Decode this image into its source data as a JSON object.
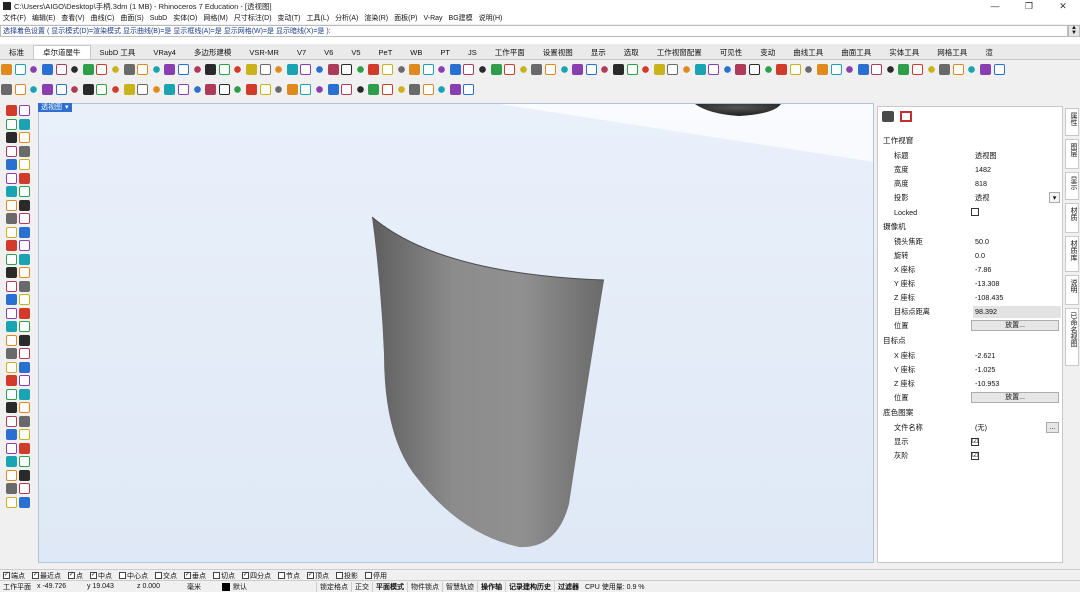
{
  "window": {
    "title": "C:\\Users\\AIGO\\Desktop\\手柄.3dm (1 MB) - Rhinoceros 7 Education - [透视图]",
    "controls": [
      "—",
      "❐",
      "✕"
    ]
  },
  "menubar": [
    "文件(F)",
    "编辑(E)",
    "查看(V)",
    "曲线(C)",
    "曲面(S)",
    "SubD",
    "实体(O)",
    "网格(M)",
    "尺寸标注(D)",
    "变动(T)",
    "工具(L)",
    "分析(A)",
    "渲染(R)",
    "面板(P)",
    "V-Ray",
    "BG建模",
    "说明(H)"
  ],
  "command_prompt": "选择着色设置 ( 显示模式(D)=渲染模式  显示曲线(B)=是  显示框线(A)=是  显示网格(W)=是  显示暗线(X)=是 ):",
  "tabs": [
    "标准",
    "卓尔道屋牛",
    "SubD 工具",
    "VRay4",
    "多边形建模",
    "VSR-MR",
    "V7",
    "V6",
    "V5",
    "PeT",
    "WB",
    "PT",
    "JS",
    "工作平面",
    "设置视图",
    "显示",
    "选取",
    "工作视窗配置",
    "可见性",
    "变动",
    "曲线工具",
    "曲面工具",
    "实体工具",
    "网格工具",
    "渲"
  ],
  "active_tab": "卓尔道屋牛",
  "viewport": {
    "tab_label": "透视图"
  },
  "properties": {
    "sections": {
      "viewport": "工作视窗",
      "camera": "摄像机",
      "target": "目标点",
      "wallpaper": "底色图案"
    },
    "viewport_rows": [
      {
        "label": "标题",
        "value": "透视图"
      },
      {
        "label": "宽度",
        "value": "1482"
      },
      {
        "label": "高度",
        "value": "818"
      },
      {
        "label": "投影",
        "value": "透视"
      },
      {
        "label": "Locked",
        "value": ""
      }
    ],
    "camera_rows": [
      {
        "label": "镜头焦距",
        "value": "50.0"
      },
      {
        "label": "旋转",
        "value": "0.0"
      },
      {
        "label": "X 座标",
        "value": "-7.86"
      },
      {
        "label": "Y 座标",
        "value": "-13.308"
      },
      {
        "label": "Z 座标",
        "value": "-108.435"
      },
      {
        "label": "目标点距离",
        "value": "98.392"
      },
      {
        "label": "位置",
        "value": "放置..."
      }
    ],
    "target_rows": [
      {
        "label": "X 座标",
        "value": "-2.621"
      },
      {
        "label": "Y 座标",
        "value": "-1.025"
      },
      {
        "label": "Z 座标",
        "value": "-10.953"
      },
      {
        "label": "位置",
        "value": "放置..."
      }
    ],
    "wallpaper_rows": [
      {
        "label": "文件名称",
        "value": "(无)"
      },
      {
        "label": "显示",
        "value": "☑"
      },
      {
        "label": "灰阶",
        "value": "☑"
      }
    ],
    "browse_label": "..."
  },
  "side_tabs": [
    "属性",
    "图层",
    "显示",
    "材质",
    "材质库",
    "说明",
    "已命名视图"
  ],
  "osnaps": [
    {
      "label": "端点",
      "checked": true
    },
    {
      "label": "最近点",
      "checked": true
    },
    {
      "label": "点",
      "checked": true
    },
    {
      "label": "中点",
      "checked": true
    },
    {
      "label": "中心点",
      "checked": false
    },
    {
      "label": "交点",
      "checked": false
    },
    {
      "label": "垂点",
      "checked": true
    },
    {
      "label": "切点",
      "checked": false
    },
    {
      "label": "四分点",
      "checked": true
    },
    {
      "label": "节点",
      "checked": false
    },
    {
      "label": "顶点",
      "checked": true
    },
    {
      "label": "投影",
      "checked": false
    },
    {
      "label": "停用",
      "checked": false
    }
  ],
  "status": {
    "cplane": "工作平面",
    "x": "x -49.726",
    "y": "y 19.043",
    "z": "z 0.000",
    "unit": "毫米",
    "layer": "默认",
    "toggles": [
      "锁定格点",
      "正交",
      "平面模式",
      "物件锁点",
      "智慧轨迹",
      "操作轴",
      "记录建构历史",
      "过滤器"
    ],
    "cpu": "CPU 使用量: 0.9 %"
  }
}
